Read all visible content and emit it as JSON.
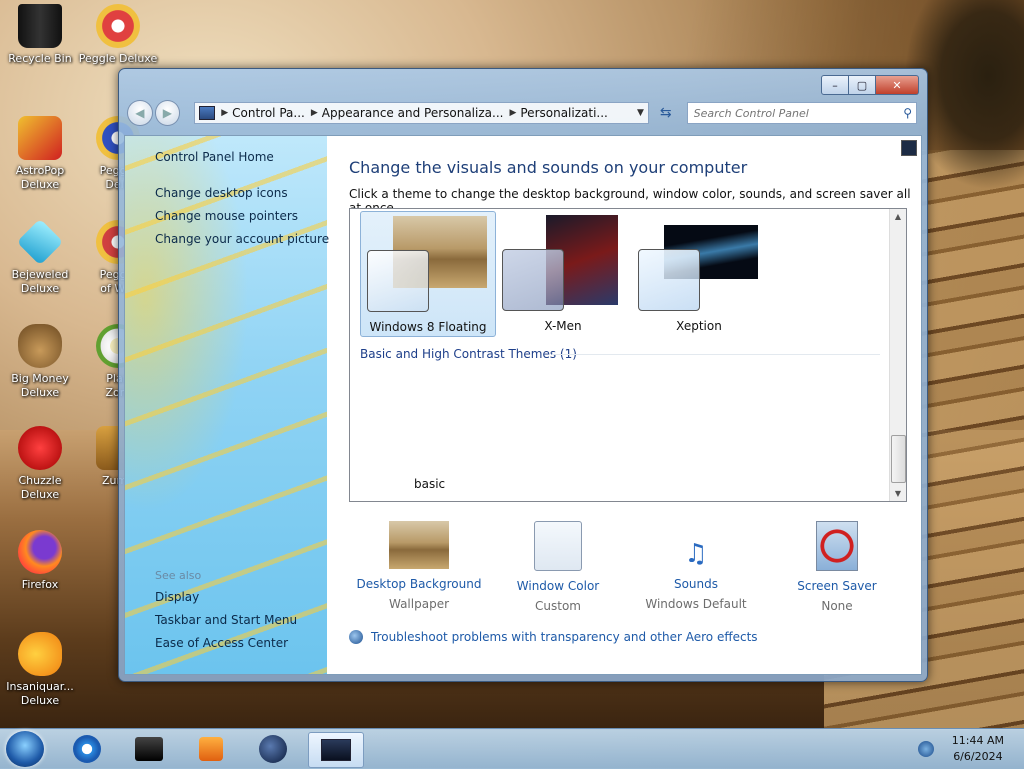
{
  "desktop": {
    "icons": [
      {
        "label1": "Recycle Bin",
        "label2": ""
      },
      {
        "label1": "Peggle Deluxe",
        "label2": ""
      },
      {
        "label1": "AstroPop",
        "label2": "Deluxe"
      },
      {
        "label1": "Peggle",
        "label2": "Delu"
      },
      {
        "label1": "Bejeweled",
        "label2": "Deluxe"
      },
      {
        "label1": "Peggle",
        "label2": "of War"
      },
      {
        "label1": "Big Money",
        "label2": "Deluxe"
      },
      {
        "label1": "Plan",
        "label2": "Zom"
      },
      {
        "label1": "Chuzzle",
        "label2": "Deluxe"
      },
      {
        "label1": "Zuma",
        "label2": ""
      },
      {
        "label1": "Firefox",
        "label2": ""
      },
      {
        "label1": "Insaniquar...",
        "label2": "Deluxe"
      }
    ]
  },
  "window": {
    "caption_buttons": {
      "minimize": "–",
      "maximize": "▢",
      "close": "✕"
    },
    "breadcrumbs": [
      "Control Pa...",
      "Appearance and Personaliza...",
      "Personalizati..."
    ],
    "search_placeholder": "Search Control Panel",
    "sidebar": {
      "home": "Control Panel Home",
      "links": [
        "Change desktop icons",
        "Change mouse pointers",
        "Change your account picture"
      ],
      "see_also_header": "See also",
      "see_also": [
        "Display",
        "Taskbar and Start Menu",
        "Ease of Access Center"
      ]
    },
    "main": {
      "title": "Change the visuals and sounds on your computer",
      "subtitle": "Click a theme to change the desktop background, window color, sounds, and screen saver all at once.",
      "themes": [
        {
          "name": "Windows 8 Floating",
          "selected": true
        },
        {
          "name": "X-Men",
          "selected": false
        },
        {
          "name": "Xeption",
          "selected": false
        }
      ],
      "group_header": "Basic and High Contrast Themes (1)",
      "basic_theme": "basic",
      "settings": [
        {
          "link": "Desktop Background",
          "value": "Wallpaper"
        },
        {
          "link": "Window Color",
          "value": "Custom"
        },
        {
          "link": "Sounds",
          "value": "Windows Default"
        },
        {
          "link": "Screen Saver",
          "value": "None"
        }
      ],
      "troubleshoot": "Troubleshoot problems with transparency and other Aero effects"
    }
  },
  "taskbar": {
    "time": "11:44 AM",
    "date": "6/6/2024"
  },
  "colors": {
    "accent_link": "#1e5aa8",
    "title_blue": "#1e3f78"
  }
}
